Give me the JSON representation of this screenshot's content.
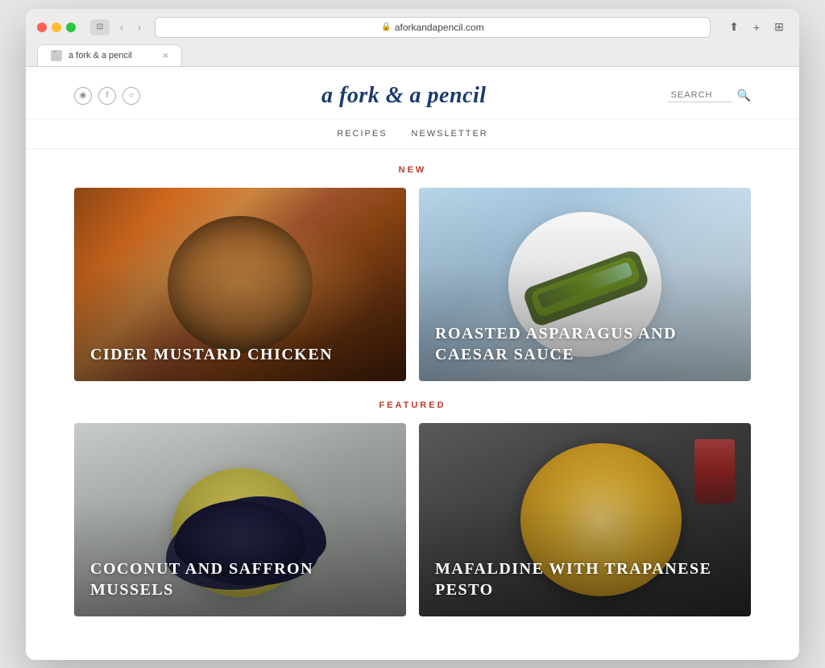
{
  "browser": {
    "address": "aforkandapencil.com",
    "tab_title": "a fork & a pencil",
    "close_symbol": "×",
    "back_arrow": "‹",
    "forward_arrow": "›"
  },
  "header": {
    "title": "a fork & a pencil",
    "search_placeholder": "SEARCH",
    "social": [
      {
        "name": "rss",
        "symbol": "◉"
      },
      {
        "name": "facebook",
        "symbol": "f"
      },
      {
        "name": "instagram",
        "symbol": "○"
      }
    ]
  },
  "nav": {
    "links": [
      {
        "label": "RECIPES"
      },
      {
        "label": "NEWSLETTER"
      }
    ]
  },
  "sections": [
    {
      "id": "new",
      "label": "NEW",
      "recipes": [
        {
          "id": "cider-mustard-chicken",
          "title": "CIDER MUSTARD CHICKEN",
          "food_type": "cider-chicken"
        },
        {
          "id": "roasted-asparagus",
          "title": "ROASTED ASPARAGUS AND CAESAR SAUCE",
          "food_type": "asparagus"
        }
      ]
    },
    {
      "id": "featured",
      "label": "FEATURED",
      "recipes": [
        {
          "id": "coconut-saffron-mussels",
          "title": "COCONUT AND SAFFRON MUSSELS",
          "food_type": "mussels"
        },
        {
          "id": "mafaldine-trapanese-pesto",
          "title": "MAFALDINE WITH TRAPANESE PESTO",
          "food_type": "pasta"
        }
      ]
    }
  ]
}
